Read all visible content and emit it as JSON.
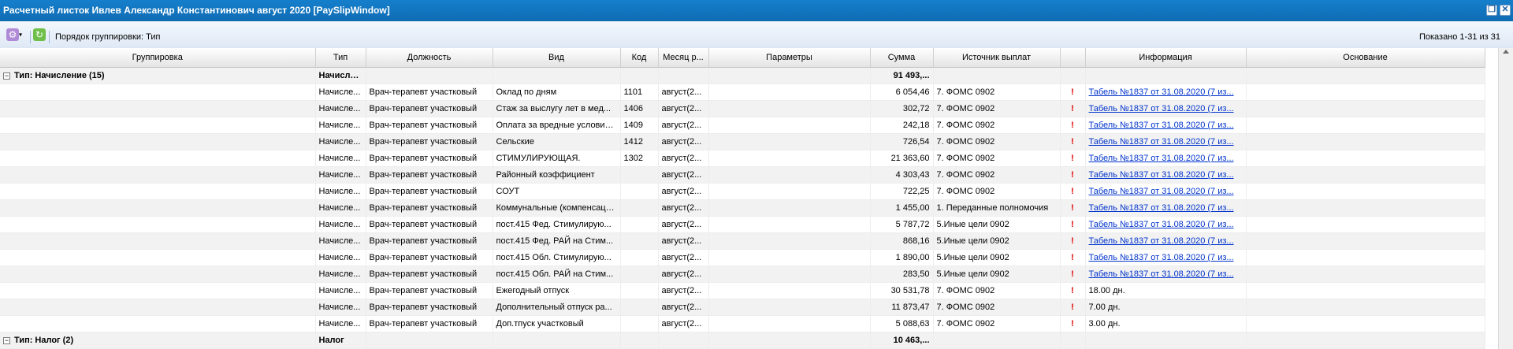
{
  "window": {
    "title": "Расчетный листок Ивлев Александр Константинович август 2020 [PaySlipWindow]",
    "restore_icon": "restore-icon",
    "close_icon": "close-icon"
  },
  "toolbar": {
    "group_order_label": "Порядок группировки:",
    "group_order_value": "Тип",
    "shown_text": "Показано 1-31 из 31"
  },
  "columns": [
    "Группировка",
    "Тип",
    "Должность",
    "Вид",
    "Код",
    "Месяц р...",
    "Параметры",
    "Сумма",
    "Источник выплат",
    "",
    "Информация",
    "Основание"
  ],
  "groups": [
    {
      "label": "Тип: Начисление (15)",
      "type": "Начисле...",
      "sum": "91 493,...",
      "rows": [
        {
          "type": "Начисле...",
          "position": "Врач-терапевт участковый",
          "kind": "Оклад по дням",
          "code": "1101",
          "month": "август(2...",
          "params": "",
          "sum": "6 054,46",
          "source": "7. ФОМС 0902",
          "flag": "!",
          "info": "Табель №1837 от 31.08.2020 (7 из...",
          "basis": ""
        },
        {
          "type": "Начисле...",
          "position": "Врач-терапевт участковый",
          "kind": "Стаж за выслугу лет в мед...",
          "code": "1406",
          "month": "август(2...",
          "params": "",
          "sum": "302,72",
          "source": "7. ФОМС 0902",
          "flag": "!",
          "info": "Табель №1837 от 31.08.2020 (7 из...",
          "basis": ""
        },
        {
          "type": "Начисле...",
          "position": "Врач-терапевт участковый",
          "kind": "Оплата за вредные условия...",
          "code": "1409",
          "month": "август(2...",
          "params": "",
          "sum": "242,18",
          "source": "7. ФОМС 0902",
          "flag": "!",
          "info": "Табель №1837 от 31.08.2020 (7 из...",
          "basis": ""
        },
        {
          "type": "Начисле...",
          "position": "Врач-терапевт участковый",
          "kind": "Сельские",
          "code": "1412",
          "month": "август(2...",
          "params": "",
          "sum": "726,54",
          "source": "7. ФОМС 0902",
          "flag": "!",
          "info": "Табель №1837 от 31.08.2020 (7 из...",
          "basis": ""
        },
        {
          "type": "Начисле...",
          "position": "Врач-терапевт участковый",
          "kind": "СТИМУЛИРУЮЩАЯ.",
          "code": "1302",
          "month": "август(2...",
          "params": "",
          "sum": "21 363,60",
          "source": "7. ФОМС 0902",
          "flag": "!",
          "info": "Табель №1837 от 31.08.2020 (7 из...",
          "basis": ""
        },
        {
          "type": "Начисле...",
          "position": "Врач-терапевт участковый",
          "kind": "Районный коэффициент",
          "code": "",
          "month": "август(2...",
          "params": "",
          "sum": "4 303,43",
          "source": "7. ФОМС 0902",
          "flag": "!",
          "info": "Табель №1837 от 31.08.2020 (7 из...",
          "basis": ""
        },
        {
          "type": "Начисле...",
          "position": "Врач-терапевт участковый",
          "kind": "СОУТ",
          "code": "",
          "month": "август(2...",
          "params": "",
          "sum": "722,25",
          "source": "7. ФОМС 0902",
          "flag": "!",
          "info": "Табель №1837 от 31.08.2020 (7 из...",
          "basis": ""
        },
        {
          "type": "Начисле...",
          "position": "Врач-терапевт участковый",
          "kind": "Коммунальные (компенсаци...",
          "code": "",
          "month": "август(2...",
          "params": "",
          "sum": "1 455,00",
          "source": "1. Переданные полномочия",
          "flag": "!",
          "info": "Табель №1837 от 31.08.2020 (7 из...",
          "basis": ""
        },
        {
          "type": "Начисле...",
          "position": "Врач-терапевт участковый",
          "kind": "пост.415 Фед. Стимулирую...",
          "code": "",
          "month": "август(2...",
          "params": "",
          "sum": "5 787,72",
          "source": "5.Иные цели 0902",
          "flag": "!",
          "info": "Табель №1837 от 31.08.2020 (7 из...",
          "basis": ""
        },
        {
          "type": "Начисле...",
          "position": "Врач-терапевт участковый",
          "kind": "пост.415 Фед. РАЙ на Стим...",
          "code": "",
          "month": "август(2...",
          "params": "",
          "sum": "868,16",
          "source": "5.Иные цели 0902",
          "flag": "!",
          "info": "Табель №1837 от 31.08.2020 (7 из...",
          "basis": ""
        },
        {
          "type": "Начисле...",
          "position": "Врач-терапевт участковый",
          "kind": "пост.415 Обл. Стимулирую...",
          "code": "",
          "month": "август(2...",
          "params": "",
          "sum": "1 890,00",
          "source": "5.Иные цели 0902",
          "flag": "!",
          "info": "Табель №1837 от 31.08.2020 (7 из...",
          "basis": ""
        },
        {
          "type": "Начисле...",
          "position": "Врач-терапевт участковый",
          "kind": "пост.415 Обл. РАЙ на Стим...",
          "code": "",
          "month": "август(2...",
          "params": "",
          "sum": "283,50",
          "source": "5.Иные цели 0902",
          "flag": "!",
          "info": "Табель №1837 от 31.08.2020 (7 из...",
          "basis": ""
        },
        {
          "type": "Начисле...",
          "position": "Врач-терапевт участковый",
          "kind": "Ежегодный отпуск",
          "code": "",
          "month": "август(2...",
          "params": "",
          "sum": "30 531,78",
          "source": "7. ФОМС 0902",
          "flag": "!",
          "info": "18.00 дн.",
          "basis": ""
        },
        {
          "type": "Начисле...",
          "position": "Врач-терапевт участковый",
          "kind": "Дополнительный отпуск ра...",
          "code": "",
          "month": "август(2...",
          "params": "",
          "sum": "11 873,47",
          "source": "7. ФОМС 0902",
          "flag": "!",
          "info": "7.00 дн.",
          "basis": ""
        },
        {
          "type": "Начисле...",
          "position": "Врач-терапевт участковый",
          "kind": "Доп.тпуск участковый",
          "code": "",
          "month": "август(2...",
          "params": "",
          "sum": "5 088,63",
          "source": "7. ФОМС 0902",
          "flag": "!",
          "info": "3.00 дн.",
          "basis": ""
        }
      ]
    },
    {
      "label": "Тип: Налог (2)",
      "type": "Налог",
      "sum": "10 463,...",
      "rows": []
    }
  ]
}
